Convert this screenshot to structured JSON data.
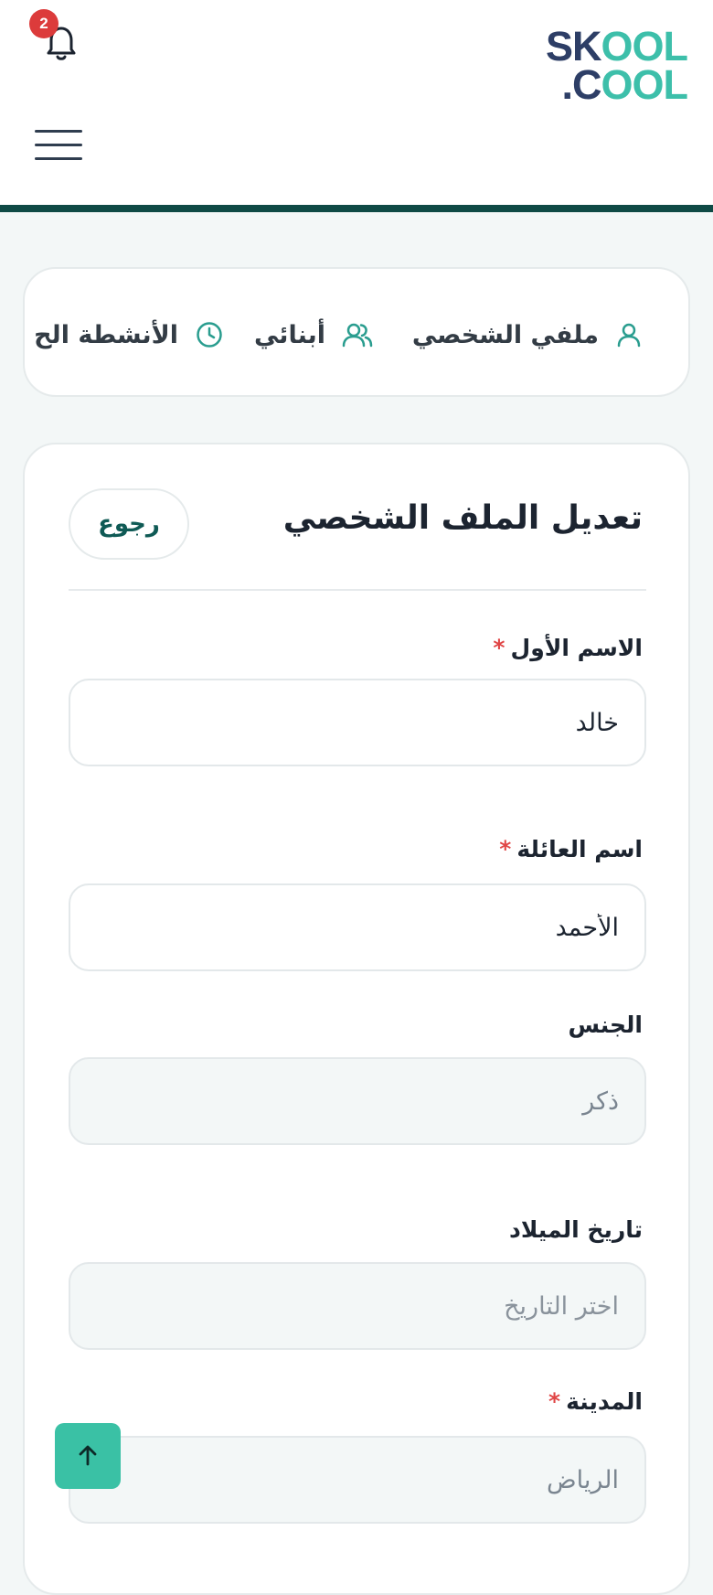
{
  "header": {
    "notification_count": "2",
    "logo_line1_part1": "SK",
    "logo_line1_part2": "OOL",
    "logo_line2_part1": ".C",
    "logo_line2_part2": "OOL"
  },
  "tabs": [
    {
      "label": "ملفي الشخصي",
      "icon": "user-icon"
    },
    {
      "label": "أبنائي",
      "icon": "users-icon"
    },
    {
      "label": "الأنشطة الح",
      "icon": "clock-icon"
    }
  ],
  "form": {
    "title": "تعديل الملف الشخصي",
    "back_label": "رجوع",
    "first_name": {
      "label": "الاسم الأول",
      "required": "*",
      "value": "خالد"
    },
    "last_name": {
      "label": "اسم العائلة",
      "required": "*",
      "value": "الأحمد"
    },
    "gender": {
      "label": "الجنس",
      "value": "ذكر"
    },
    "birth_date": {
      "label": "تاريخ الميلاد",
      "placeholder": "اختر التاريخ"
    },
    "city": {
      "label": "المدينة",
      "required": "*",
      "value": "الرياض"
    }
  },
  "colors": {
    "accent": "#3ac1a5",
    "header_border": "#0f4a45",
    "required": "#e04545",
    "badge": "#dc3b3b"
  }
}
